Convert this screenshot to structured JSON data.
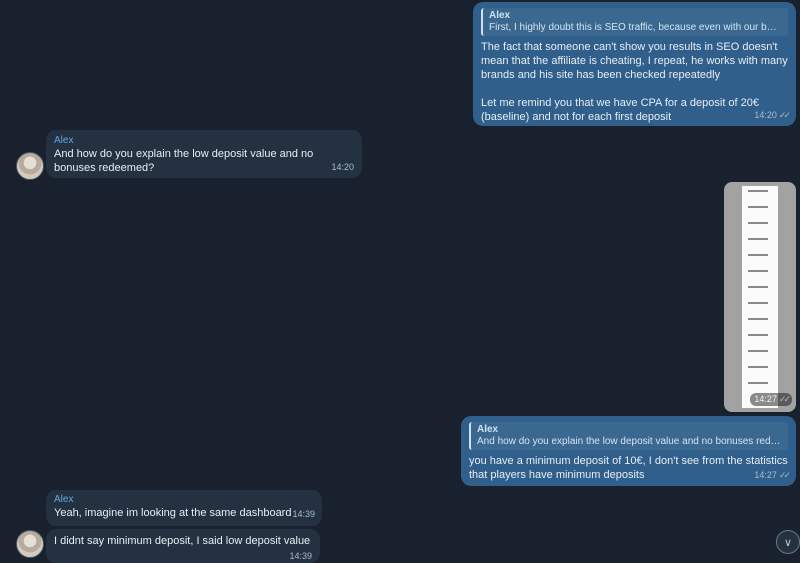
{
  "messages": [
    {
      "reply_name": "Alex",
      "reply_text": "First, I highly doubt this is SEO traffic, because even with our best...",
      "text": "The fact that someone can't show you results in SEO doesn't mean that the affiliate is cheating, I repeat, he works with many brands and his site has been checked repeatedly\n\nLet me remind you that we have CPA for a deposit of 20€ (baseline) and not for each first deposit",
      "time": "14:20",
      "ticks": "✓✓"
    },
    {
      "sender": "Alex",
      "text": "And how do you explain the low deposit value and no bonuses redeemed?",
      "time": "14:20"
    },
    {
      "time": "14:27",
      "ticks": "✓✓"
    },
    {
      "reply_name": "Alex",
      "reply_text": "And how do you explain the low deposit value and no bonuses redeem...",
      "text": "you have a minimum deposit of 10€, I don't see from the statistics that players have minimum deposits",
      "time": "14:27",
      "ticks": "✓✓"
    },
    {
      "sender": "Alex",
      "text": "Yeah, imagine im looking at the same dashboard",
      "time": "14:39"
    },
    {
      "text": "I didnt say minimum deposit, I said low deposit value",
      "time": "14:39"
    }
  ],
  "scroll_icon": "chevron-down-icon"
}
